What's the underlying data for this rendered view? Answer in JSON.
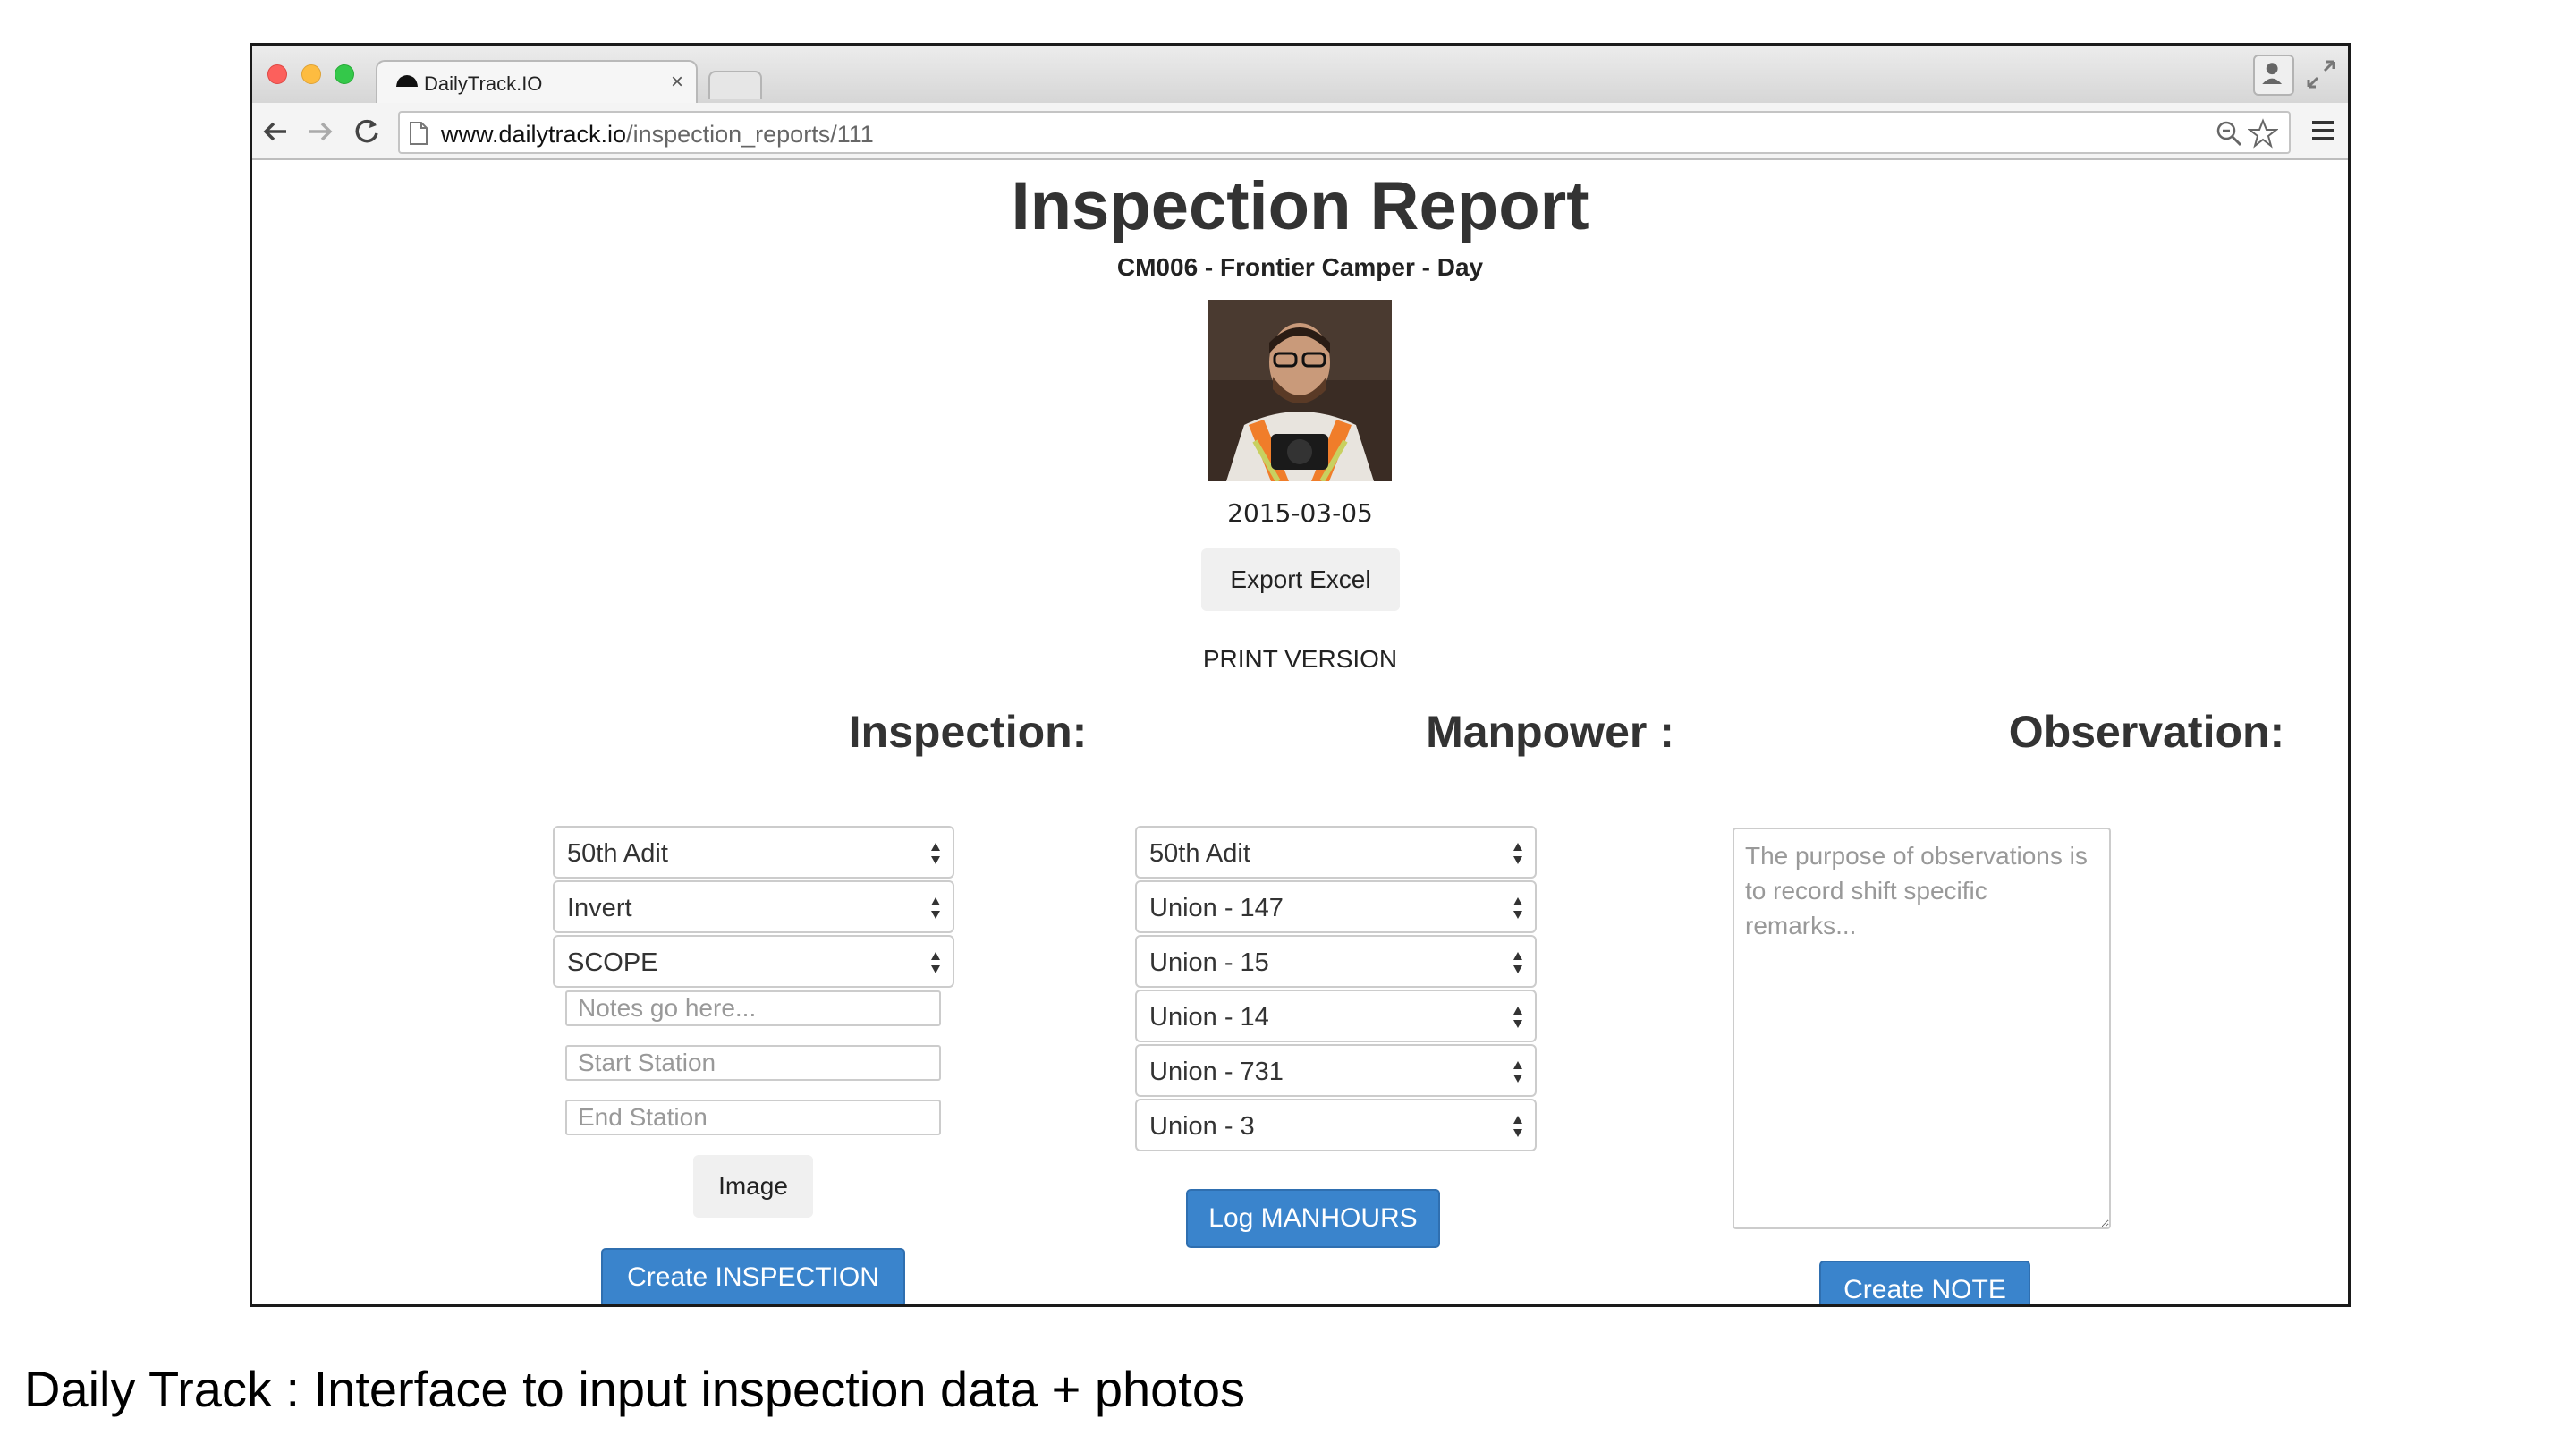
{
  "browser": {
    "tab_title": "DailyTrack.IO",
    "tab_close": "×",
    "url_host": "www.dailytrack.io",
    "url_path": "/inspection_reports/111"
  },
  "report": {
    "title": "Inspection Report",
    "subtitle": "CM006 - Frontier Camper - Day",
    "date": "2015-03-05",
    "export_label": "Export Excel",
    "print_label": "PRINT VERSION"
  },
  "inspection": {
    "heading": "Inspection:",
    "selects": [
      "50th Adit",
      "Invert",
      "SCOPE"
    ],
    "notes_placeholder": "Notes go here...",
    "start_station_placeholder": "Start Station",
    "end_station_placeholder": "End Station",
    "image_label": "Image",
    "create_label": "Create INSPECTION"
  },
  "manpower": {
    "heading": "Manpower :",
    "selects": [
      "50th Adit",
      "Union - 147",
      "Union - 15",
      "Union - 14",
      "Union - 731",
      "Union - 3"
    ],
    "log_label": "Log MANHOURS"
  },
  "observation": {
    "heading": "Observation:",
    "placeholder": "The purpose of observations is to record shift specific remarks...",
    "create_label": "Create NOTE"
  },
  "caption": "Daily Track : Interface to input inspection data + photos",
  "colors": {
    "primary_button": "#3a84cc",
    "heading_text": "#333333",
    "border": "#cccccc"
  }
}
